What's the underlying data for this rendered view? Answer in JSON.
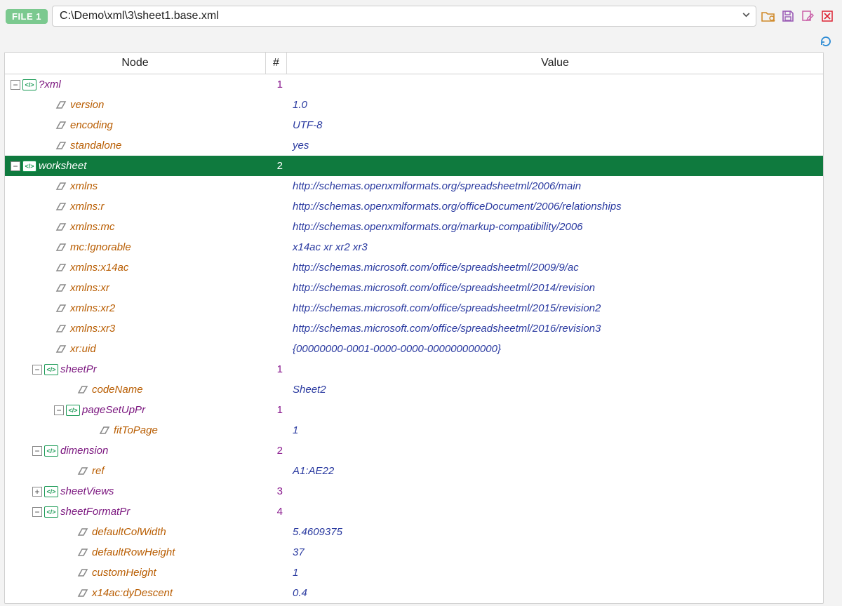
{
  "toolbar": {
    "file_badge": "FILE 1",
    "path": "C:\\Demo\\xml\\3\\sheet1.base.xml"
  },
  "headers": {
    "node": "Node",
    "count": "#",
    "value": "Value"
  },
  "rows": [
    {
      "indent": 0,
      "toggle": "−",
      "icon": "elem",
      "name": "?xml",
      "nameClass": "elem-name",
      "count": "1",
      "value": "",
      "selected": false
    },
    {
      "indent": 2,
      "toggle": "",
      "icon": "attr",
      "name": "version",
      "nameClass": "attr-name",
      "count": "",
      "value": "1.0",
      "selected": false
    },
    {
      "indent": 2,
      "toggle": "",
      "icon": "attr",
      "name": "encoding",
      "nameClass": "attr-name",
      "count": "",
      "value": "UTF-8",
      "selected": false
    },
    {
      "indent": 2,
      "toggle": "",
      "icon": "attr",
      "name": "standalone",
      "nameClass": "attr-name",
      "count": "",
      "value": "yes",
      "selected": false
    },
    {
      "indent": 0,
      "toggle": "−",
      "icon": "elem",
      "name": "worksheet",
      "nameClass": "elem-name",
      "count": "2",
      "value": "",
      "selected": true
    },
    {
      "indent": 2,
      "toggle": "",
      "icon": "attr",
      "name": "xmlns",
      "nameClass": "attr-name",
      "count": "",
      "value": "http://schemas.openxmlformats.org/spreadsheetml/2006/main",
      "selected": false
    },
    {
      "indent": 2,
      "toggle": "",
      "icon": "attr",
      "name": "xmlns:r",
      "nameClass": "attr-name",
      "count": "",
      "value": "http://schemas.openxmlformats.org/officeDocument/2006/relationships",
      "selected": false
    },
    {
      "indent": 2,
      "toggle": "",
      "icon": "attr",
      "name": "xmlns:mc",
      "nameClass": "attr-name",
      "count": "",
      "value": "http://schemas.openxmlformats.org/markup-compatibility/2006",
      "selected": false
    },
    {
      "indent": 2,
      "toggle": "",
      "icon": "attr",
      "name": "mc:Ignorable",
      "nameClass": "attr-name",
      "count": "",
      "value": "x14ac xr xr2 xr3",
      "selected": false
    },
    {
      "indent": 2,
      "toggle": "",
      "icon": "attr",
      "name": "xmlns:x14ac",
      "nameClass": "attr-name",
      "count": "",
      "value": "http://schemas.microsoft.com/office/spreadsheetml/2009/9/ac",
      "selected": false
    },
    {
      "indent": 2,
      "toggle": "",
      "icon": "attr",
      "name": "xmlns:xr",
      "nameClass": "attr-name",
      "count": "",
      "value": "http://schemas.microsoft.com/office/spreadsheetml/2014/revision",
      "selected": false
    },
    {
      "indent": 2,
      "toggle": "",
      "icon": "attr",
      "name": "xmlns:xr2",
      "nameClass": "attr-name",
      "count": "",
      "value": "http://schemas.microsoft.com/office/spreadsheetml/2015/revision2",
      "selected": false
    },
    {
      "indent": 2,
      "toggle": "",
      "icon": "attr",
      "name": "xmlns:xr3",
      "nameClass": "attr-name",
      "count": "",
      "value": "http://schemas.microsoft.com/office/spreadsheetml/2016/revision3",
      "selected": false
    },
    {
      "indent": 2,
      "toggle": "",
      "icon": "attr",
      "name": "xr:uid",
      "nameClass": "attr-name",
      "count": "",
      "value": "{00000000-0001-0000-0000-000000000000}",
      "selected": false
    },
    {
      "indent": 1,
      "toggle": "−",
      "icon": "elem",
      "name": "sheetPr",
      "nameClass": "elem-name",
      "count": "1",
      "value": "",
      "selected": false
    },
    {
      "indent": 3,
      "toggle": "",
      "icon": "attr",
      "name": "codeName",
      "nameClass": "attr-name",
      "count": "",
      "value": "Sheet2",
      "selected": false
    },
    {
      "indent": 2,
      "toggle": "−",
      "icon": "elem",
      "name": "pageSetUpPr",
      "nameClass": "elem-name",
      "count": "1",
      "value": "",
      "selected": false
    },
    {
      "indent": 4,
      "toggle": "",
      "icon": "attr",
      "name": "fitToPage",
      "nameClass": "attr-name",
      "count": "",
      "value": "1",
      "selected": false
    },
    {
      "indent": 1,
      "toggle": "−",
      "icon": "elem",
      "name": "dimension",
      "nameClass": "elem-name",
      "count": "2",
      "value": "",
      "selected": false
    },
    {
      "indent": 3,
      "toggle": "",
      "icon": "attr",
      "name": "ref",
      "nameClass": "attr-name",
      "count": "",
      "value": "A1:AE22",
      "selected": false
    },
    {
      "indent": 1,
      "toggle": "+",
      "icon": "elem",
      "name": "sheetViews",
      "nameClass": "elem-name",
      "count": "3",
      "value": "",
      "selected": false
    },
    {
      "indent": 1,
      "toggle": "−",
      "icon": "elem",
      "name": "sheetFormatPr",
      "nameClass": "elem-name",
      "count": "4",
      "value": "",
      "selected": false
    },
    {
      "indent": 3,
      "toggle": "",
      "icon": "attr",
      "name": "defaultColWidth",
      "nameClass": "attr-name",
      "count": "",
      "value": "5.4609375",
      "selected": false
    },
    {
      "indent": 3,
      "toggle": "",
      "icon": "attr",
      "name": "defaultRowHeight",
      "nameClass": "attr-name",
      "count": "",
      "value": "37",
      "selected": false
    },
    {
      "indent": 3,
      "toggle": "",
      "icon": "attr",
      "name": "customHeight",
      "nameClass": "attr-name",
      "count": "",
      "value": "1",
      "selected": false
    },
    {
      "indent": 3,
      "toggle": "",
      "icon": "attr",
      "name": "x14ac:dyDescent",
      "nameClass": "attr-name",
      "count": "",
      "value": "0.4",
      "selected": false
    }
  ]
}
